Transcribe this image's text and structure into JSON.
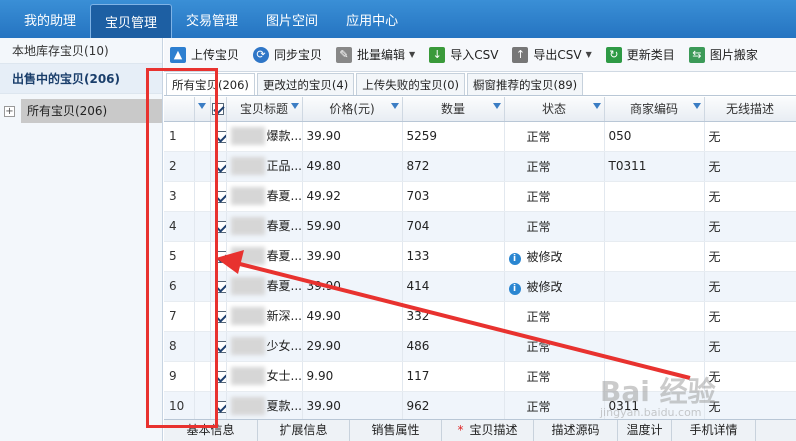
{
  "topnav": {
    "tabs": [
      {
        "label": "我的助理",
        "active": false
      },
      {
        "label": "宝贝管理",
        "active": true
      },
      {
        "label": "交易管理",
        "active": false
      },
      {
        "label": "图片空间",
        "active": false
      },
      {
        "label": "应用中心",
        "active": false
      }
    ]
  },
  "sidebar": {
    "local": "本地库存宝贝(10)",
    "selling": "出售中的宝贝(206)",
    "tree_label": "所有宝贝(206)"
  },
  "toolbar": {
    "upload": "上传宝贝",
    "sync": "同步宝贝",
    "batch_edit": "批量编辑",
    "import_csv": "导入CSV",
    "export_csv": "导出CSV",
    "update_category": "更新类目",
    "image_move": "图片搬家"
  },
  "subtabs": [
    {
      "label": "所有宝贝(206)",
      "active": true
    },
    {
      "label": "更改过的宝贝(4)",
      "active": false
    },
    {
      "label": "上传失败的宝贝(0)",
      "active": false
    },
    {
      "label": "橱窗推荐的宝贝(89)",
      "active": false
    }
  ],
  "table": {
    "headers": {
      "title": "宝贝标题",
      "price": "价格(元)",
      "qty": "数量",
      "status": "状态",
      "code": "商家编码",
      "wireless": "无线描述"
    },
    "rows": [
      {
        "n": "1",
        "title": "爆款...",
        "price": "39.90",
        "qty": "5259",
        "status": "正常",
        "modified": false,
        "code": "050",
        "wireless": "无"
      },
      {
        "n": "2",
        "title": "正品...",
        "price": "49.80",
        "qty": "872",
        "status": "正常",
        "modified": false,
        "code": "T0311",
        "wireless": "无"
      },
      {
        "n": "3",
        "title": "春夏...",
        "price": "49.92",
        "qty": "703",
        "status": "正常",
        "modified": false,
        "code": "",
        "wireless": "无"
      },
      {
        "n": "4",
        "title": "春夏...",
        "price": "59.90",
        "qty": "704",
        "status": "正常",
        "modified": false,
        "code": "",
        "wireless": "无"
      },
      {
        "n": "5",
        "title": "春夏...",
        "price": "39.90",
        "qty": "133",
        "status": "被修改",
        "modified": true,
        "code": "",
        "wireless": "无"
      },
      {
        "n": "6",
        "title": "春夏...",
        "price": "39.90",
        "qty": "414",
        "status": "被修改",
        "modified": true,
        "code": "",
        "wireless": "无"
      },
      {
        "n": "7",
        "title": "新深...",
        "price": "49.90",
        "qty": "332",
        "status": "正常",
        "modified": false,
        "code": "",
        "wireless": "无"
      },
      {
        "n": "8",
        "title": "少女...",
        "price": "29.90",
        "qty": "486",
        "status": "正常",
        "modified": false,
        "code": "",
        "wireless": "无"
      },
      {
        "n": "9",
        "title": "女士...",
        "price": "9.90",
        "qty": "117",
        "status": "正常",
        "modified": false,
        "code": "",
        "wireless": "无"
      },
      {
        "n": "10",
        "title": "夏款...",
        "price": "39.90",
        "qty": "962",
        "status": "正常",
        "modified": false,
        "code": "0311",
        "wireless": "无"
      }
    ]
  },
  "bottom_tabs": [
    "基本信息",
    "扩展信息",
    "销售属性",
    "宝贝描述",
    "描述源码",
    "温度计",
    "手机详情"
  ],
  "watermark": {
    "brand": "Bai 经验",
    "url": "jingyan.baidu.com"
  },
  "colors": {
    "nav": "#2574c1",
    "annotation": "#e8322f"
  }
}
